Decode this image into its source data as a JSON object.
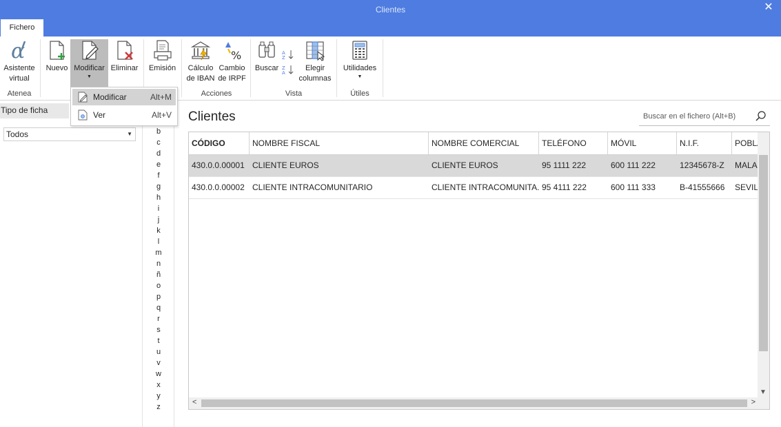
{
  "window": {
    "title": "Clientes",
    "close_glyph": "✕"
  },
  "tabs": [
    {
      "label": "Fichero",
      "active": true
    }
  ],
  "ribbon": {
    "asistente": "Asistente\nvirtual",
    "asistente_l1": "Asistente",
    "asistente_l2": "virtual",
    "nuevo": "Nuevo",
    "modificar": "Modificar",
    "eliminar": "Eliminar",
    "emision": "Emisión",
    "calculo_l1": "Cálculo",
    "calculo_l2": "de IBAN",
    "cambio_l1": "Cambio",
    "cambio_l2": "de IRPF",
    "buscar": "Buscar",
    "elegir_l1": "Elegir",
    "elegir_l2": "columnas",
    "utilidades": "Utilidades",
    "groups": {
      "atenea": "Atenea",
      "acciones": "Acciones",
      "vista": "Vista",
      "utiles": "Útiles"
    }
  },
  "menu": {
    "items": [
      {
        "label": "Modificar",
        "shortcut": "Alt+M"
      },
      {
        "label": "Ver",
        "shortcut": "Alt+V"
      }
    ]
  },
  "left_panel": {
    "header": "Tipo de ficha",
    "selected": "Todos"
  },
  "alphabet": [
    "b",
    "c",
    "d",
    "e",
    "f",
    "g",
    "h",
    "i",
    "j",
    "k",
    "l",
    "m",
    "n",
    "ñ",
    "o",
    "p",
    "q",
    "r",
    "s",
    "t",
    "u",
    "v",
    "w",
    "x",
    "y",
    "z"
  ],
  "main": {
    "title": "Clientes",
    "search_placeholder": "Buscar en el fichero (Alt+B)"
  },
  "table": {
    "columns": [
      "CÓDIGO",
      "NOMBRE FISCAL",
      "NOMBRE COMERCIAL",
      "TELÉFONO",
      "MÓVIL",
      "N.I.F.",
      "POBLA"
    ],
    "rows": [
      [
        "430.0.0.00001",
        "CLIENTE EUROS",
        "CLIENTE EUROS",
        "95 1111 222",
        "600 111 222",
        "12345678-Z",
        "MALA"
      ],
      [
        "430.0.0.00002",
        "CLIENTE INTRACOMUNITARIO",
        "CLIENTE INTRACOMUNITA...",
        "95 4111 222",
        "600 111 333",
        "B-41555666",
        "SEVILL"
      ]
    ]
  },
  "colors": {
    "titlebar": "#4f7ce0",
    "selected_row": "#d9d9d9",
    "accent_green": "#2e9e3e",
    "delete_red": "#d13438"
  }
}
